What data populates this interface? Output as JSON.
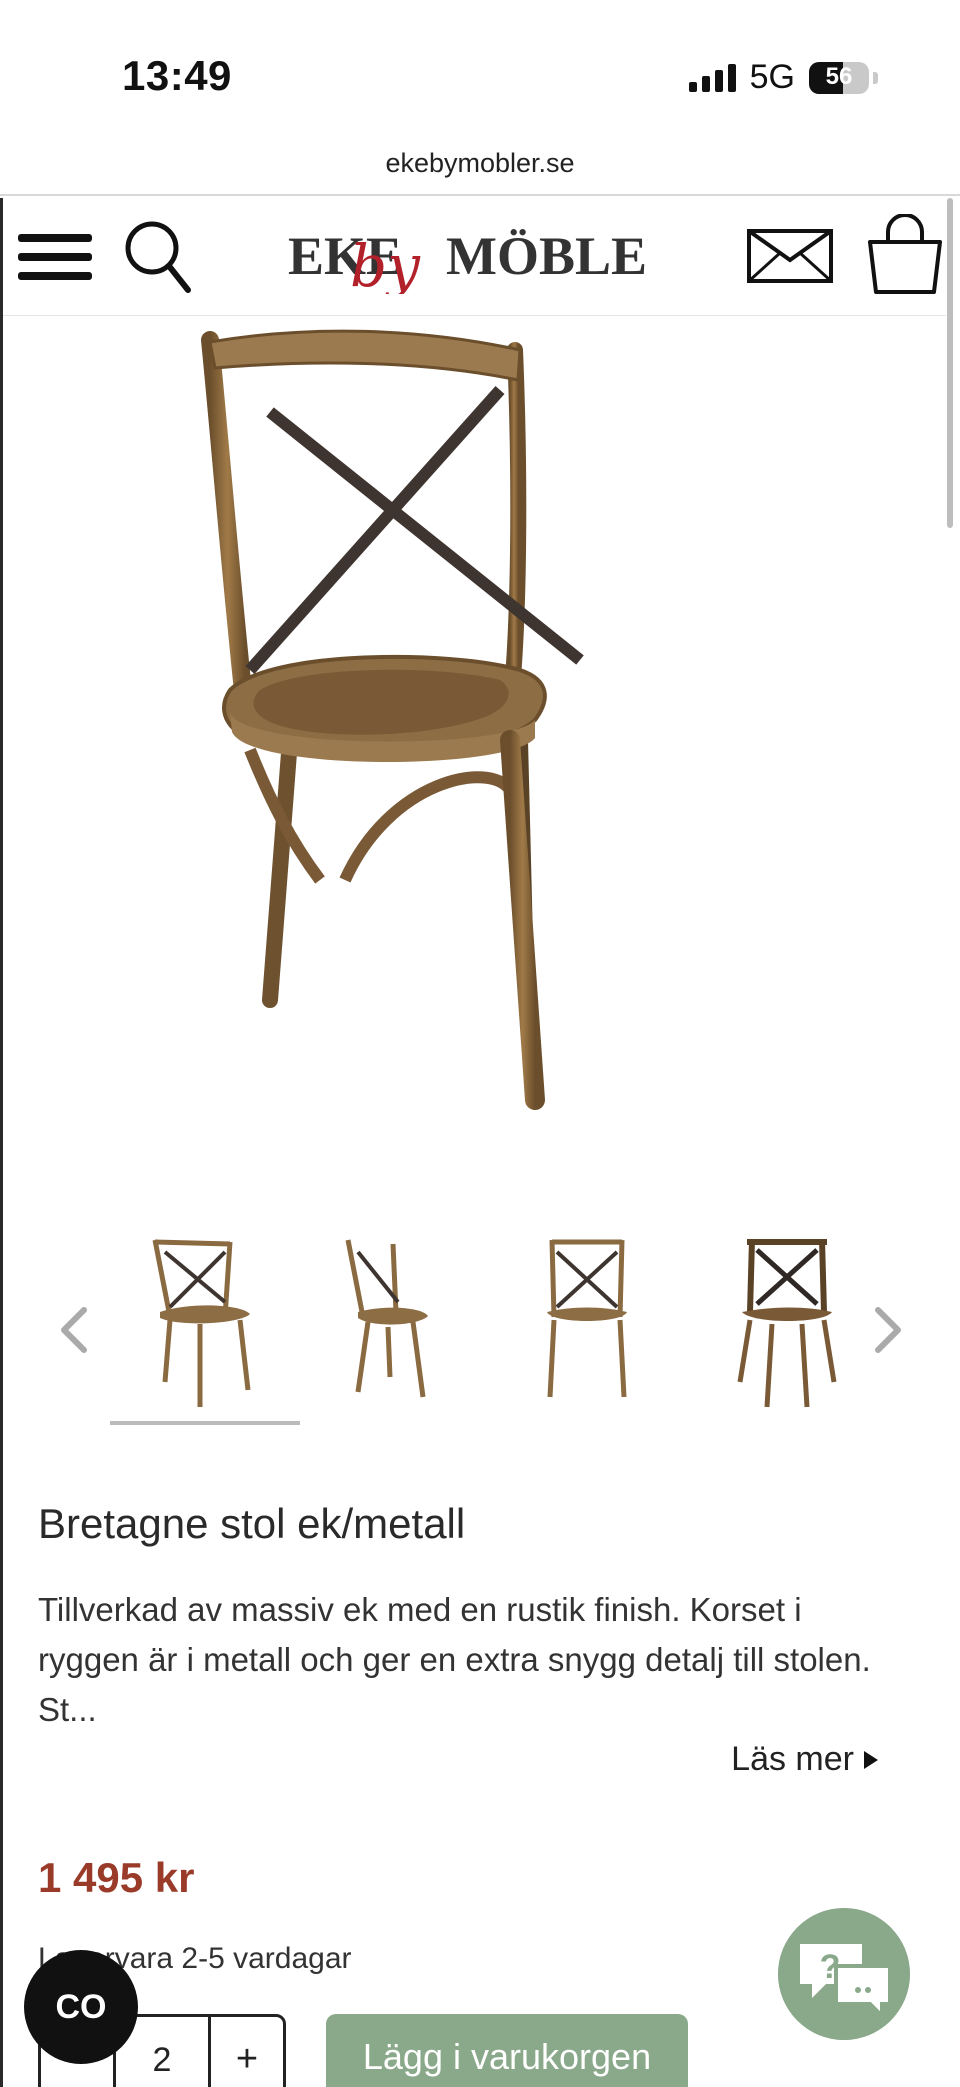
{
  "status": {
    "time": "13:49",
    "network": "5G",
    "battery_level": 56,
    "battery_label": "56"
  },
  "browser": {
    "url": "ekebymobler.se"
  },
  "header": {
    "logo_text": "EKEbyMÖBLER",
    "logo_left": "EKE",
    "logo_script": "by",
    "logo_right": "MÖBLER"
  },
  "gallery": {
    "thumbnail_count": 4,
    "selected_index": 0
  },
  "product": {
    "title": "Bretagne stol ek/metall",
    "description": "Tillverkad av massiv ek med en rustik finish. Korset i ryggen är i metall och ger en extra snygg detalj till stolen. St...",
    "read_more": "Läs mer",
    "price": "1 495 kr",
    "stock": "Lagervara 2-5 vardagar",
    "quantity": "2",
    "minus_label": "−",
    "plus_label": "+",
    "add_to_cart": "Lägg i varukorgen"
  },
  "floating": {
    "co_label": "CO",
    "chat_label": "?"
  },
  "colors": {
    "brand_red": "#b2202a",
    "price": "#9a3b2a",
    "button_green": "#8aa88a"
  }
}
